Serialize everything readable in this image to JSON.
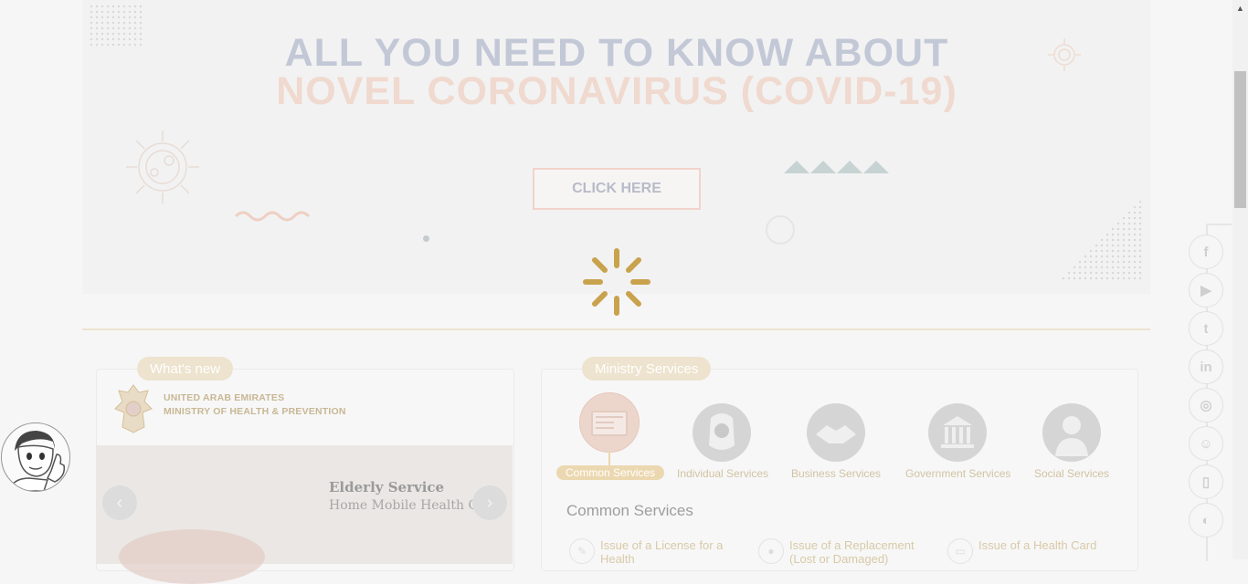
{
  "hero": {
    "title_line1": "ALL YOU NEED TO KNOW ABOUT",
    "title_line2": "NOVEL CORONAVIRUS (COVID-19)",
    "cta_label": "CLICK HERE"
  },
  "whats_new": {
    "tab_label": "What's new",
    "org_line1": "UNITED ARAB EMIRATES",
    "org_line2": "MINISTRY OF HEALTH & PREVENTION",
    "slide_title": "Elderly Service",
    "slide_subtitle": "Home Mobile Health Care",
    "prev_icon": "‹",
    "next_icon": "›"
  },
  "ministry_services": {
    "tab_label": "Ministry Services",
    "categories": [
      {
        "label": "Common Services",
        "active": true
      },
      {
        "label": "Individual Services",
        "active": false
      },
      {
        "label": "Business Services",
        "active": false
      },
      {
        "label": "Government Services",
        "active": false
      },
      {
        "label": "Social Services",
        "active": false
      }
    ],
    "section_heading": "Common Services",
    "items": [
      {
        "label": "Issue of a License for a Health"
      },
      {
        "label": "Issue of a Replacement (Lost or Damaged)"
      },
      {
        "label": "Issue of a Health Card"
      }
    ]
  },
  "social": [
    {
      "name": "facebook",
      "glyph": "f"
    },
    {
      "name": "youtube",
      "glyph": "▶"
    },
    {
      "name": "twitter",
      "glyph": "t"
    },
    {
      "name": "linkedin",
      "glyph": "in"
    },
    {
      "name": "instagram",
      "glyph": "◎"
    },
    {
      "name": "happiness",
      "glyph": "☺"
    },
    {
      "name": "mobile",
      "glyph": "▯"
    },
    {
      "name": "accessibility",
      "glyph": "◐"
    }
  ],
  "colors": {
    "title_blue": "#c3c8d7",
    "title_peach": "#f0d9cf",
    "gold": "#c9a24e",
    "pill": "#ede3ce"
  }
}
